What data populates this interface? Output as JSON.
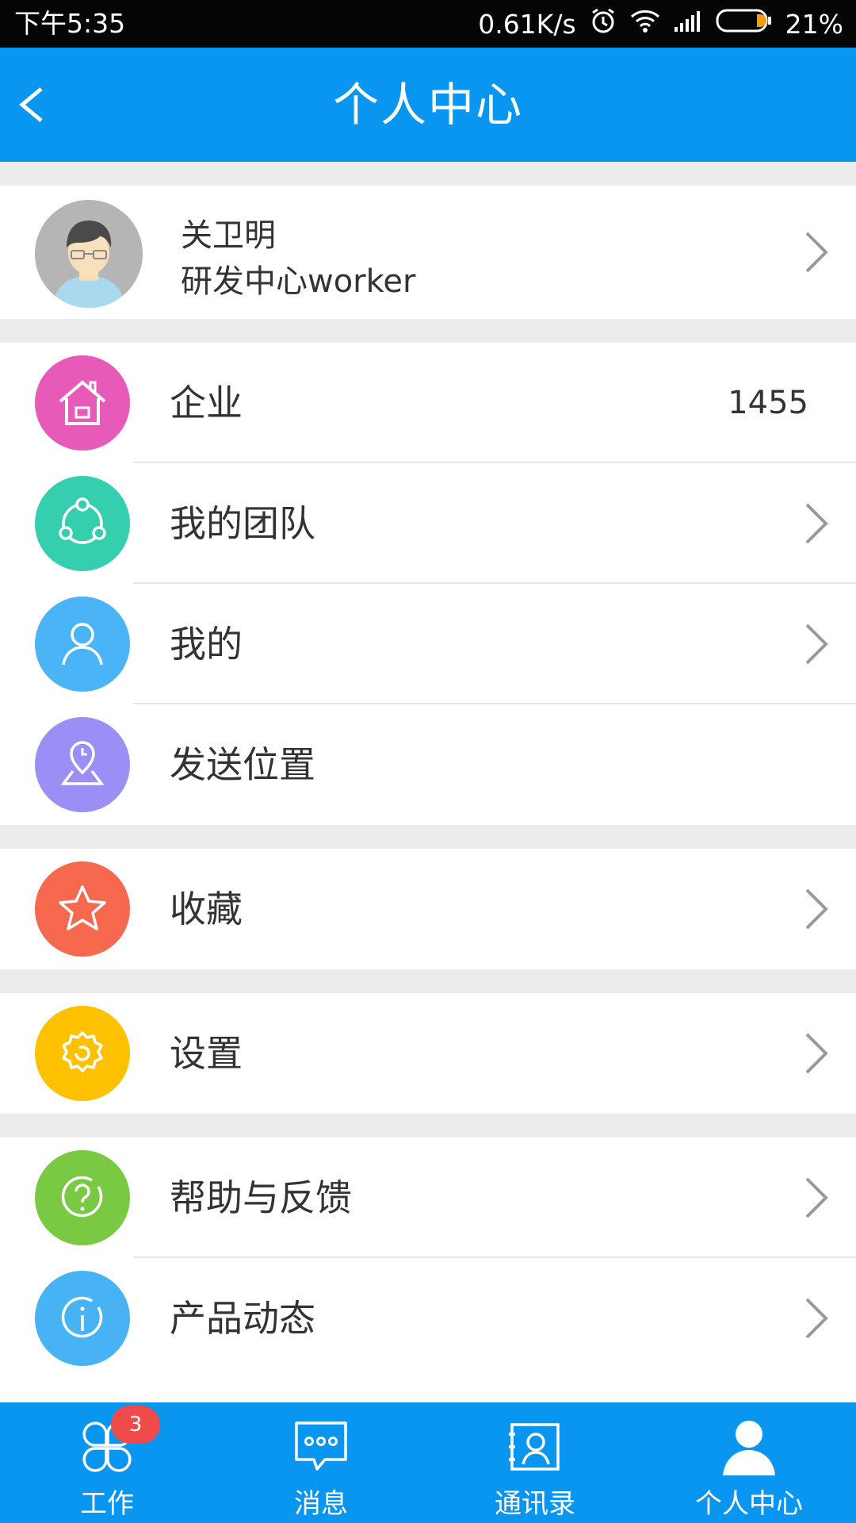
{
  "status_bar": {
    "time": "下午5:35",
    "speed": "0.61K/s",
    "battery": "21%",
    "icons": [
      "alarm-icon",
      "wifi-icon",
      "signal-icon",
      "battery-icon"
    ]
  },
  "header": {
    "title": "个人中心",
    "back_icon": "chevron-left-icon"
  },
  "profile": {
    "name": "关卫明",
    "department": "研发中心worker"
  },
  "groups": [
    {
      "items": [
        {
          "label": "企业",
          "value": "1455",
          "icon": "house-icon",
          "color": "#e85ab8"
        },
        {
          "label": "我的团队",
          "icon": "team-icon",
          "color": "#35cfb0"
        },
        {
          "label": "我的",
          "icon": "person-icon",
          "color": "#4ab4f7"
        },
        {
          "label": "发送位置",
          "icon": "location-icon",
          "color": "#9a8ff5"
        }
      ]
    },
    {
      "items": [
        {
          "label": "收藏",
          "icon": "star-icon",
          "color": "#f6694f"
        }
      ]
    },
    {
      "items": [
        {
          "label": "设置",
          "icon": "gear-icon",
          "color": "#fdc100"
        }
      ]
    },
    {
      "items": [
        {
          "label": "帮助与反馈",
          "icon": "question-icon",
          "color": "#7ac943"
        },
        {
          "label": "产品动态",
          "icon": "info-icon",
          "color": "#47b3f5"
        }
      ]
    }
  ],
  "tabs": [
    {
      "label": "工作",
      "badge": "3",
      "icon": "clover-icon"
    },
    {
      "label": "消息",
      "icon": "message-icon"
    },
    {
      "label": "通讯录",
      "icon": "contacts-icon"
    },
    {
      "label": "个人中心",
      "icon": "person-icon",
      "active": true
    }
  ],
  "colors": {
    "primary": "#0896f1",
    "badge": "#ef4b4b",
    "background": "#ececec"
  }
}
